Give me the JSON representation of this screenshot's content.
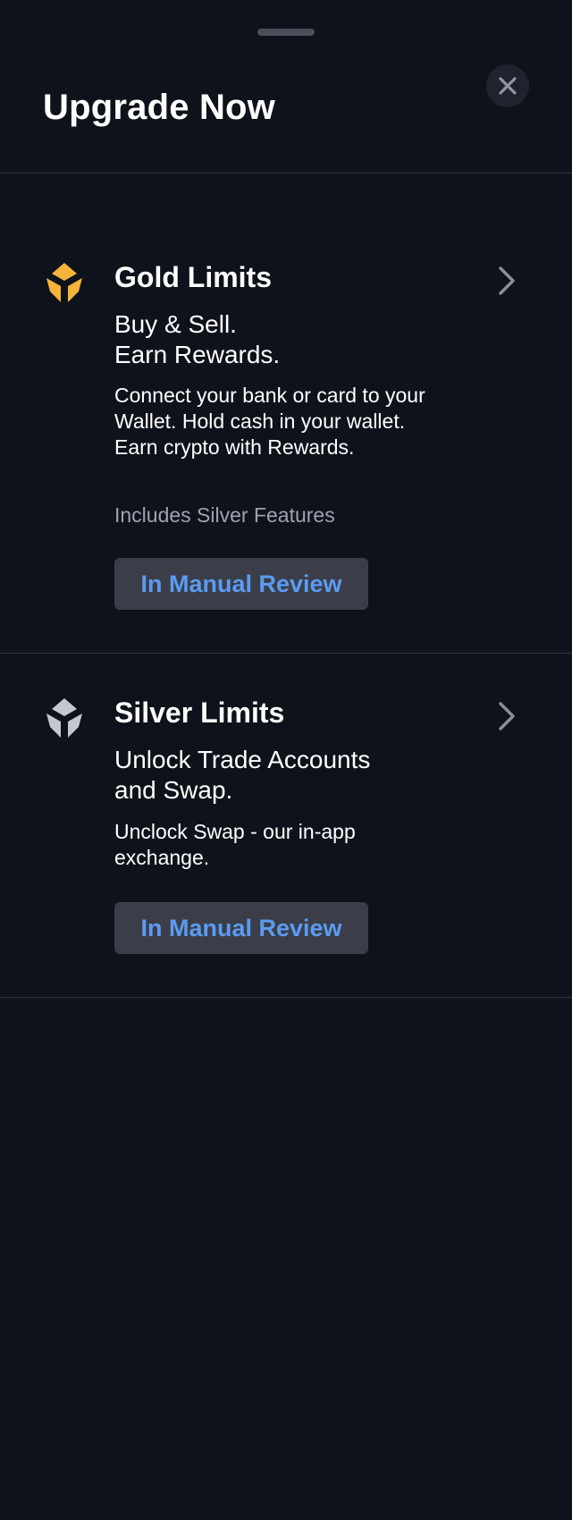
{
  "header": {
    "title": "Upgrade Now"
  },
  "tiers": [
    {
      "title": "Gold Limits",
      "headline_line1": "Buy & Sell.",
      "headline_line2": "Earn Rewards.",
      "description": "Connect your bank or card to your Wallet. Hold cash in your wallet. Earn crypto with Rewards.",
      "includes": "Includes Silver Features",
      "button_label": "In Manual Review",
      "icon": "gold-tier-icon",
      "icon_color": "#f4b43a"
    },
    {
      "title": "Silver Limits",
      "headline_line1": "Unlock Trade Accounts",
      "headline_line2": "and Swap.",
      "description": "Unclock Swap - our in-app exchange.",
      "button_label": "In Manual Review",
      "icon": "silver-tier-icon",
      "icon_color": "#c3c7d0"
    }
  ],
  "colors": {
    "background": "#0e121b",
    "divider": "#2e323c",
    "button_bg": "#3b3e49",
    "button_text": "#5b9bf2",
    "muted_text": "#9ea3ae"
  }
}
